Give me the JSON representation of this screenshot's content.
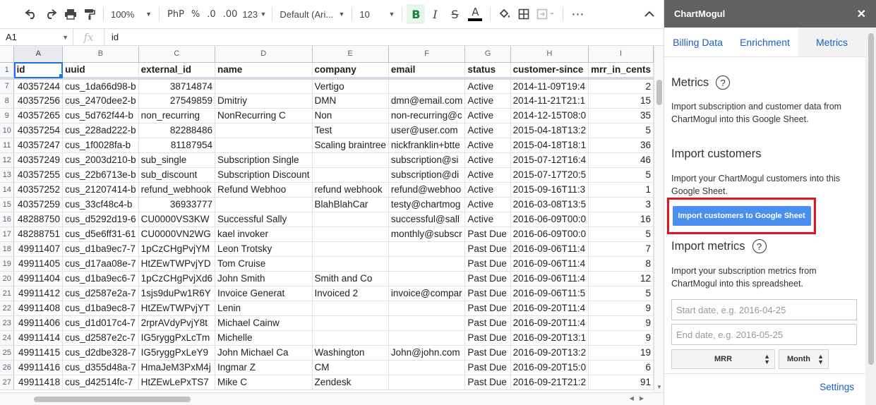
{
  "toolbar": {
    "zoom": "100%",
    "currency": "PhP",
    "percent": "%",
    "dec_decrease": ".0",
    "dec_increase": ".00",
    "more_formats": "123",
    "font": "Default (Ari...",
    "font_size": "10",
    "bold": "B",
    "italic": "I",
    "strike": "S",
    "text_color": "A"
  },
  "formula_bar": {
    "cell_ref": "A1",
    "fx": "fx",
    "value": "id"
  },
  "sheet": {
    "columns": [
      "A",
      "B",
      "C",
      "D",
      "E",
      "F",
      "G",
      "H",
      "I"
    ],
    "header_row_number": "1",
    "header": [
      "id",
      "uuid",
      "external_id",
      "name",
      "company",
      "email",
      "status",
      "customer-since",
      "mrr_in_cents"
    ],
    "rows": [
      [
        "7",
        "40357244",
        "cus_1da66d98-b",
        "38714874",
        "",
        "Vertigo",
        "",
        "Active",
        "2014-11-09T19:4",
        "2"
      ],
      [
        "8",
        "40357256",
        "cus_2470dee2-b",
        "27549859",
        "Dmitriy",
        "DMN",
        "dmn@email.com",
        "Active",
        "2014-11-21T21:1",
        "15"
      ],
      [
        "9",
        "40357265",
        "cus_5d762f44-b",
        "non_recurring",
        "NonRecurring C",
        "Non",
        "non-recurring@c",
        "Active",
        "2014-12-15T08:0",
        "35"
      ],
      [
        "10",
        "40357254",
        "cus_228ad222-b",
        "82288486",
        "",
        "Test",
        "user@user.com",
        "Active",
        "2015-04-18T13:2",
        "5"
      ],
      [
        "11",
        "40357247",
        "cus_1f0028fa-b",
        "81187954",
        "",
        "Scaling braintree",
        "nickfranklin+btte",
        "Active",
        "2015-04-18T18:1",
        "36"
      ],
      [
        "12",
        "40357249",
        "cus_2003d210-b",
        "sub_single",
        "Subscription Single",
        "",
        "subscription@si",
        "Active",
        "2015-07-12T16:4",
        "46"
      ],
      [
        "13",
        "40357255",
        "cus_22b6713e-b",
        "sub_discount",
        "Subscription Discount",
        "",
        "subscription@di",
        "Active",
        "2015-07-17T20:5",
        "5"
      ],
      [
        "14",
        "40357252",
        "cus_21207414-b",
        "refund_webhook",
        "Refund Webhoo",
        "refund webhook",
        "refund@webhoo",
        "Active",
        "2015-09-16T11:3",
        "1"
      ],
      [
        "15",
        "40357259",
        "cus_33cf48c4-b",
        "36933777",
        "",
        "BlahBlahCar",
        "testy@chartmog",
        "Active",
        "2016-03-08T13:5",
        "3"
      ],
      [
        "16",
        "48288750",
        "cus_d5292d19-6",
        "CU0000VS3KW",
        "Successful Sally",
        "",
        "successful@sall",
        "Active",
        "2016-06-09T00:0",
        "16"
      ],
      [
        "17",
        "48288751",
        "cus_d5e6ff31-61",
        "CU0000VN2WG",
        "kael invoker",
        "",
        "monthly@subscr",
        "Past Due",
        "2016-06-09T00:0",
        "5"
      ],
      [
        "18",
        "49911407",
        "cus_d1ba9ec7-7",
        "1pCzCHgPvjYM",
        "Leon Trotsky",
        "",
        "",
        "Past Due",
        "2016-09-06T11:4",
        "7"
      ],
      [
        "19",
        "49911405",
        "cus_d17aa08e-7",
        "HtZEwTWPvjYD",
        "Tom Cruise",
        "",
        "",
        "Past Due",
        "2016-09-06T11:4",
        "8"
      ],
      [
        "20",
        "49911404",
        "cus_d1ba9ec6-7",
        "1pCzCHgPvjXd6",
        "John Smith",
        "Smith and Co",
        "",
        "Past Due",
        "2016-09-06T11:4",
        "12"
      ],
      [
        "21",
        "49911412",
        "cus_d2587e2a-7",
        "1sjs9duPw1R6Y",
        "Invoice Generat",
        "Invoiced 2",
        "invoice@compar",
        "Past Due",
        "2016-09-06T11:5",
        "5"
      ],
      [
        "22",
        "49911408",
        "cus_d1ba9ec8-7",
        "HtZEwTWPvjYT",
        "Lenin",
        "",
        "",
        "Past Due",
        "2016-09-20T11:4",
        "9"
      ],
      [
        "23",
        "49911406",
        "cus_d1d017c4-7",
        "2rprAVdyPvjY8t",
        "Michael Cainw",
        "",
        "",
        "Past Due",
        "2016-09-20T11:4",
        "9"
      ],
      [
        "24",
        "49911414",
        "cus_d2587e2c-7",
        "IG5ryggPxLcTm",
        "Michelle",
        "",
        "",
        "Past Due",
        "2016-09-20T13:1",
        "9"
      ],
      [
        "25",
        "49911415",
        "cus_d2dbe328-7",
        "IG5ryggPxLeY9",
        "John Michael Ca",
        "Washington",
        "John@john.com",
        "Past Due",
        "2016-09-20T13:2",
        "19"
      ],
      [
        "26",
        "49911416",
        "cus_d355d48a-7",
        "HmaJeM3PxM4j",
        "Ingmar Z",
        "CM",
        "",
        "Past Due",
        "2016-09-20T15:0",
        "6"
      ],
      [
        "27",
        "49911418",
        "cus_d42514fc-7",
        "HtZEwLePxTS7",
        "Mike C",
        "Zendesk",
        "",
        "Past Due",
        "2016-09-21T21:2",
        "91"
      ]
    ]
  },
  "sidebar": {
    "title": "ChartMogul",
    "close": "✕",
    "tabs": [
      "Billing Data",
      "Enrichment",
      "Metrics"
    ],
    "metrics_title": "Metrics",
    "metrics_text": "Import subscription and customer data from ChartMogul into this Google Sheet.",
    "customers_title": "Import customers",
    "customers_text": "Import your ChartMogul customers into this Google Sheet.",
    "import_button": "Import customers to Google Sheet",
    "import_metrics_title": "Import metrics",
    "import_metrics_text": "Import your subscription metrics from ChartMogul into this spreadsheet.",
    "start_placeholder": "Start date, e.g. 2016-04-25",
    "end_placeholder": "End date, e.g. 2016-05-25",
    "metric_select": "MRR",
    "interval_select": "Month",
    "settings": "Settings",
    "help": "?"
  },
  "colors": {
    "accent_blue": "#1a73e8",
    "button_blue": "#4a8ff0",
    "highlight_red": "#e0151e",
    "sidebar_header": "#616161"
  }
}
